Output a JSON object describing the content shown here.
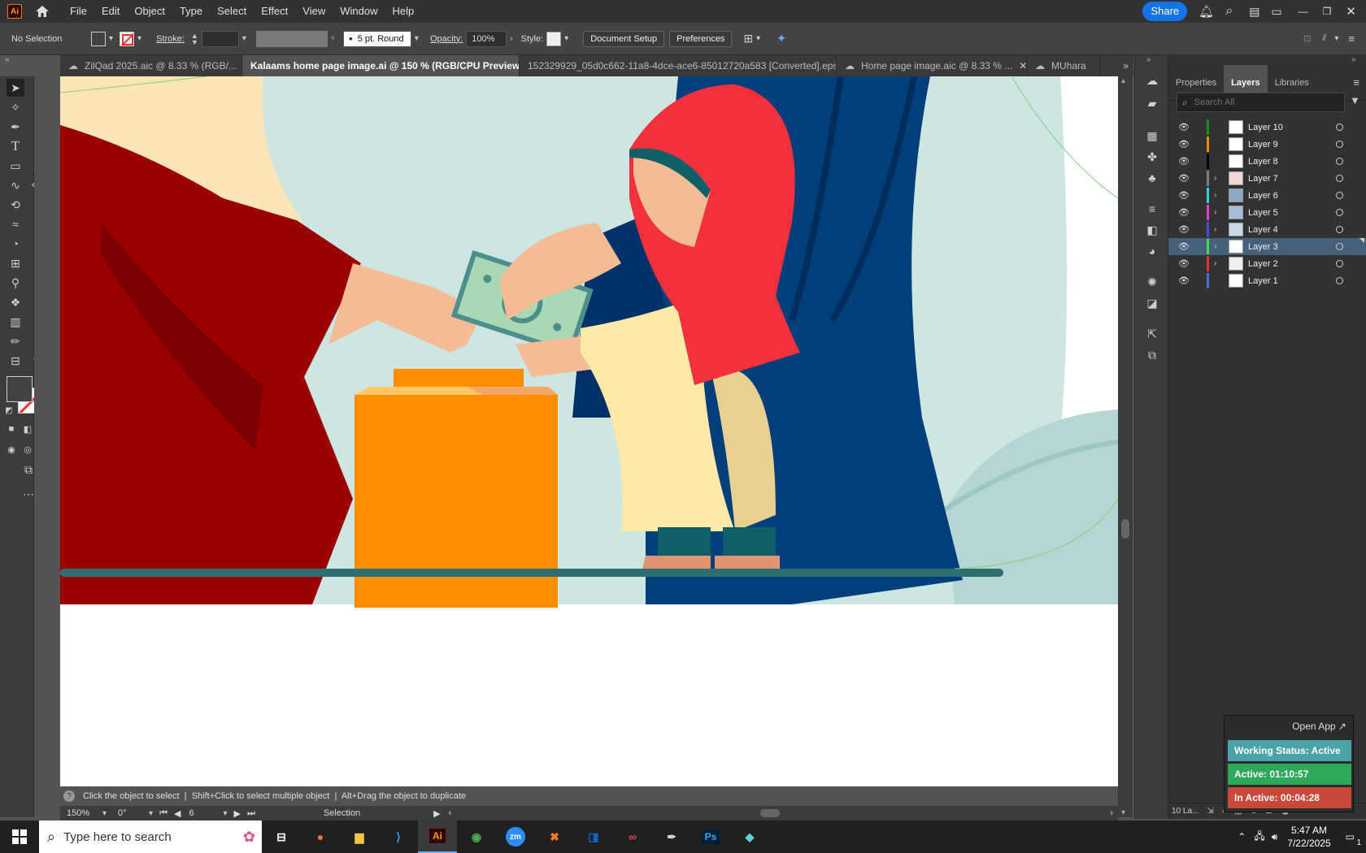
{
  "menubar": {
    "app_badge": "Ai",
    "items": [
      "File",
      "Edit",
      "Object",
      "Type",
      "Select",
      "Effect",
      "View",
      "Window",
      "Help"
    ],
    "share_label": "Share"
  },
  "controlbar": {
    "selection": "No Selection",
    "stroke_label": "Stroke:",
    "brush": "5 pt. Round",
    "opacity_label": "Opacity:",
    "opacity_value": "100%",
    "style_label": "Style:",
    "document_setup": "Document Setup",
    "preferences": "Preferences"
  },
  "tabs": [
    {
      "label": "ZilQad 2025.aic @ 8.33 % (RGB/..."
    },
    {
      "label": "Kalaams home page image.ai @ 150 % (RGB/CPU Preview)"
    },
    {
      "label": "152329929_05d0c662-11a8-4dce-ace6-85012720a583 [Converted].eps*"
    },
    {
      "label": "Home page image.aic @ 8.33 % ..."
    },
    {
      "label": "MUhara"
    }
  ],
  "panel": {
    "tabs": [
      "Properties",
      "Layers",
      "Libraries"
    ],
    "search_placeholder": "Search All",
    "layers": [
      {
        "name": "Layer 10",
        "color": "#1f8a1f",
        "expandable": false
      },
      {
        "name": "Layer 9",
        "color": "#f08a00",
        "expandable": false
      },
      {
        "name": "Layer 8",
        "color": "#000000",
        "expandable": false
      },
      {
        "name": "Layer 7",
        "color": "#7f7f7f",
        "expandable": true
      },
      {
        "name": "Layer 6",
        "color": "#2fd4e0",
        "expandable": true
      },
      {
        "name": "Layer 5",
        "color": "#e040c8",
        "expandable": true
      },
      {
        "name": "Layer 4",
        "color": "#4a4ae0",
        "expandable": true
      },
      {
        "name": "Layer 3",
        "color": "#3ee04a",
        "expandable": true,
        "selected": true
      },
      {
        "name": "Layer 2",
        "color": "#e03030",
        "expandable": true
      },
      {
        "name": "Layer 1",
        "color": "#4a6ae0",
        "expandable": false
      }
    ],
    "footer_count": "10 La..."
  },
  "status": {
    "hint": "Click the object to select  |  Shift+Click to select multiple object  |  Alt+Drag the object to duplicate",
    "zoom": "150%",
    "rotation": "0°",
    "artboard_number": "6",
    "tool_name": "Selection"
  },
  "widget": {
    "open_app": "Open App ↗",
    "working": "Working Status: Active",
    "active": "Active: 01:10:57",
    "inactive": "In Active: 00:04:28"
  },
  "taskbar": {
    "search_placeholder": "Type here to search",
    "time": "5:47 AM",
    "date": "7/22/2025",
    "notif_count": "1"
  }
}
